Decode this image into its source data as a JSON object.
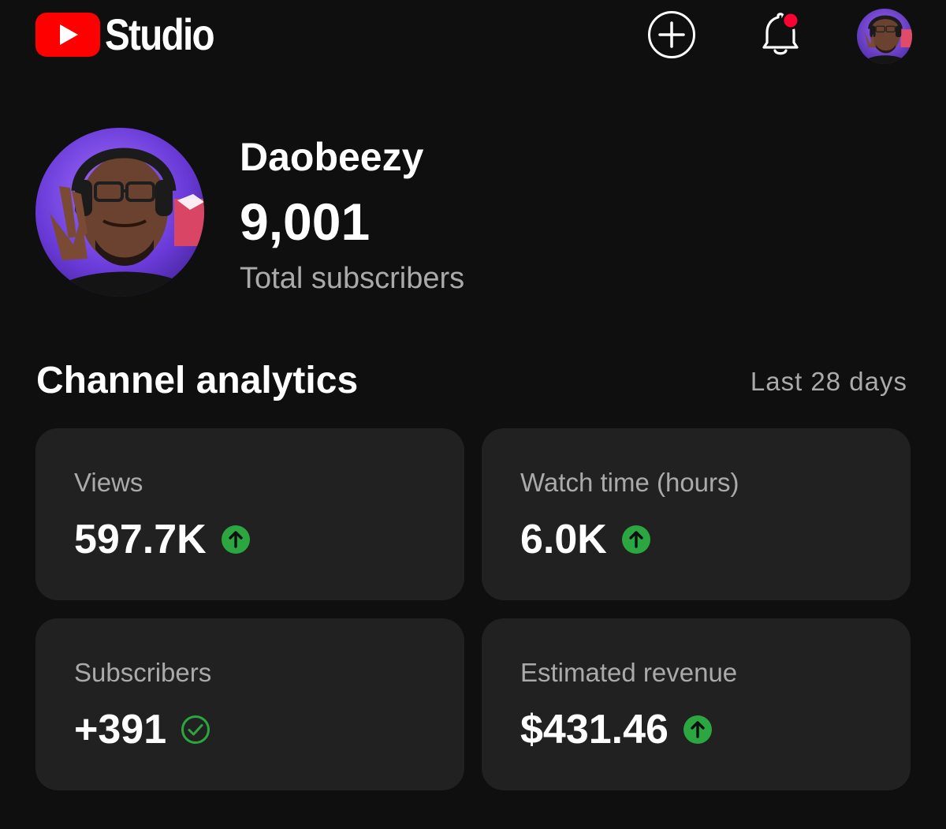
{
  "app": {
    "logo_text": "Studio",
    "brand_color": "#ff0000"
  },
  "header_icons": {
    "create": "add-circle-icon",
    "notifications": "bell-icon",
    "notification_dot_color": "#ff0033",
    "account": "avatar"
  },
  "channel": {
    "name": "Daobeezy",
    "subscriber_count": "9,001",
    "subscriber_label": "Total subscribers"
  },
  "analytics": {
    "title": "Channel analytics",
    "period": "Last 28 days",
    "positive_color": "#2ba640",
    "cards": [
      {
        "label": "Views",
        "value": "597.7K",
        "trend_icon": "arrow-up-circle-icon"
      },
      {
        "label": "Watch time (hours)",
        "value": "6.0K",
        "trend_icon": "arrow-up-circle-icon"
      },
      {
        "label": "Subscribers",
        "value": "+391",
        "trend_icon": "check-circle-icon"
      },
      {
        "label": "Estimated revenue",
        "value": "$431.46",
        "trend_icon": "arrow-up-circle-icon"
      }
    ]
  }
}
